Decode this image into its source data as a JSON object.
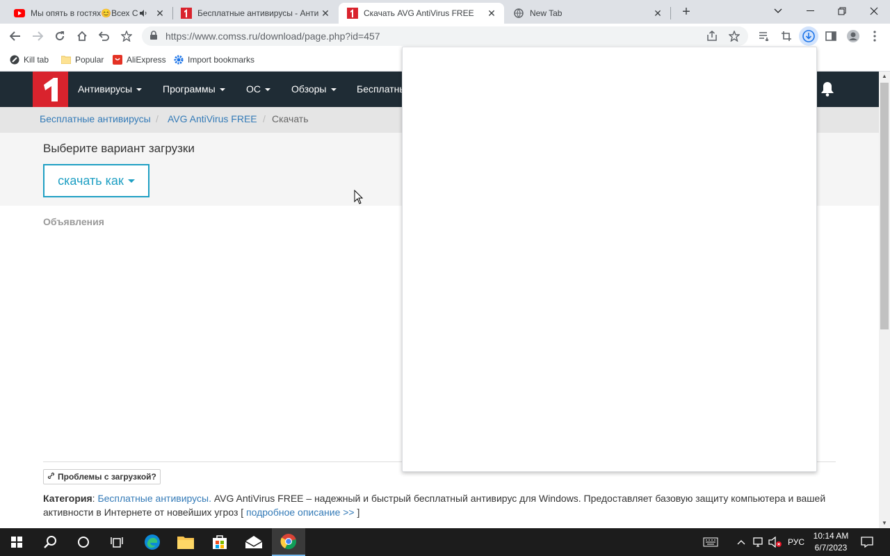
{
  "tabs": [
    {
      "title": "Мы опять в гостях😊Всех С",
      "icon": "youtube-icon",
      "muted_icon": "speaker-icon"
    },
    {
      "title": "Бесплатные антивирусы - Анти",
      "icon": "comss-logo-icon"
    },
    {
      "title": "Скачать AVG AntiVirus FREE",
      "icon": "comss-logo-icon",
      "active": true
    },
    {
      "title": "New Tab",
      "icon": "globe-icon"
    }
  ],
  "address": {
    "url": "https://www.comss.ru/download/page.php?id=457"
  },
  "bookmarks": [
    {
      "label": "Kill tab",
      "icon": "killtab-icon"
    },
    {
      "label": "Popular",
      "icon": "folder-icon"
    },
    {
      "label": "AliExpress",
      "icon": "aliexpress-icon"
    },
    {
      "label": "Import bookmarks",
      "icon": "gear-icon"
    }
  ],
  "site": {
    "nav": [
      "Антивирусы",
      "Программы",
      "ОС",
      "Обзоры",
      "Бесплатны"
    ],
    "breadcrumb": [
      "Бесплатные антивирусы",
      "AVG AntiVirus FREE",
      "Скачать"
    ],
    "download_title": "Выберите вариант загрузки",
    "download_button": "скачать как",
    "ads_label": "Объявления",
    "problems_button": "Проблемы с загрузкой?",
    "category_label": "Категория",
    "category_link": "Бесплатные антивирусы.",
    "description": " AVG AntiVirus FREE – надежный и быстрый бесплатный антивирус для Windows. Предоставляет базовую защиту компьютера и вашей активности в Интернете от новейших угроз [ ",
    "more_link": "подробное описание >>",
    "desc_end": " ]"
  },
  "taskbar": {
    "lang": "РУС",
    "time": "10:14 AM",
    "date": "6/7/2023"
  },
  "colors": {
    "nav_bg": "#1f2c35",
    "brand_red": "#d9232d",
    "accent": "#1e9fc3",
    "link": "#337ab7"
  }
}
